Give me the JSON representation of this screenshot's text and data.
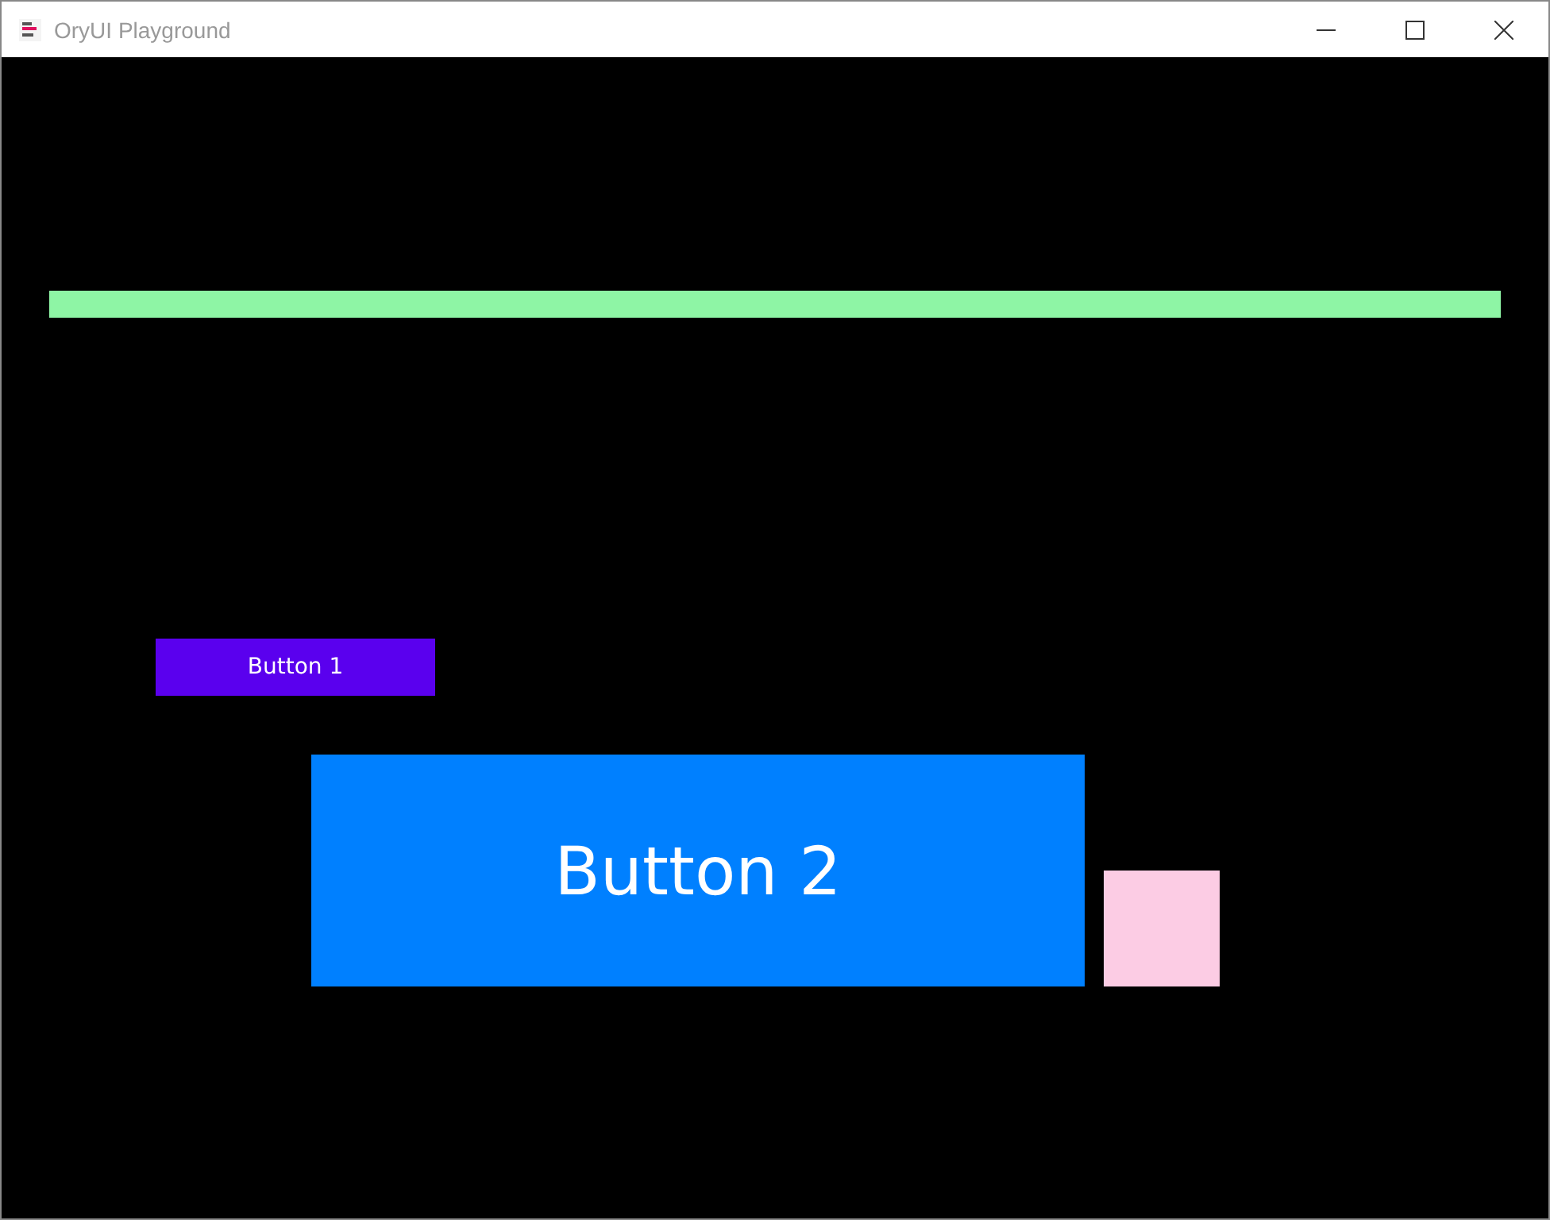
{
  "window": {
    "title": "OryUI Playground"
  },
  "buttons": [
    {
      "label": "Button 1",
      "kind": "small"
    },
    {
      "label": "Button 2",
      "kind": "large"
    }
  ]
}
